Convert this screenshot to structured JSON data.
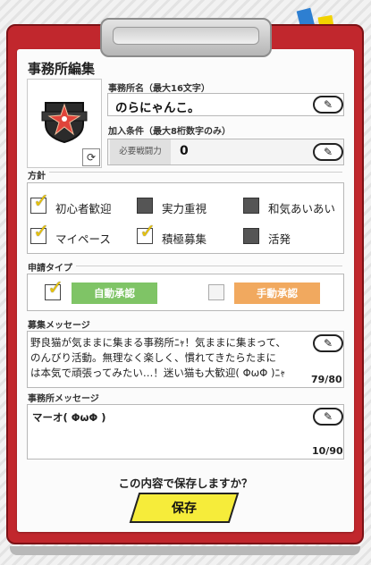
{
  "page": {
    "title": "事務所編集"
  },
  "office_name": {
    "label": "事務所名（最大16文字）",
    "value": "のらにゃんこ。"
  },
  "join": {
    "label": "加入条件（最大8桁数字のみ）",
    "field_label": "必要戦闘力",
    "value": "0"
  },
  "policy": {
    "title": "方針",
    "options": [
      {
        "label": "初心者歓迎",
        "checked": true
      },
      {
        "label": "実力重視",
        "checked": false
      },
      {
        "label": "和気あいあい",
        "checked": false
      },
      {
        "label": "マイペース",
        "checked": true
      },
      {
        "label": "積極募集",
        "checked": true
      },
      {
        "label": "活発",
        "checked": false
      }
    ]
  },
  "apply": {
    "title": "申請タイプ",
    "auto": {
      "label": "自動承認",
      "checked": true,
      "color": "#7fc466"
    },
    "manual": {
      "label": "手動承認",
      "checked": false,
      "color": "#f1a95f"
    }
  },
  "recruit": {
    "title": "募集メッセージ",
    "lines": [
      "野良猫が気ままに集まる事務所ﾆｬ！気ままに集まって、",
      "のんびり活動。無理なく楽しく、慣れてきたらたまに",
      "は本気で頑張ってみたい…！迷い猫も大歓迎( ΦωΦ )ﾆｬ"
    ],
    "count": "79/80"
  },
  "office_msg": {
    "title": "事務所メッセージ",
    "value": "マーオ( ΦωΦ )",
    "count": "10/90"
  },
  "footer": {
    "confirm": "この内容で保存しますか？",
    "save": "保存"
  },
  "icons": {
    "edit": "pencil-icon",
    "refresh": "refresh-icon",
    "emblem": "crest-emblem-icon"
  },
  "colors": {
    "board": "#c1272d",
    "save_button": "#f6ec3a",
    "check": "#e6c20b"
  }
}
